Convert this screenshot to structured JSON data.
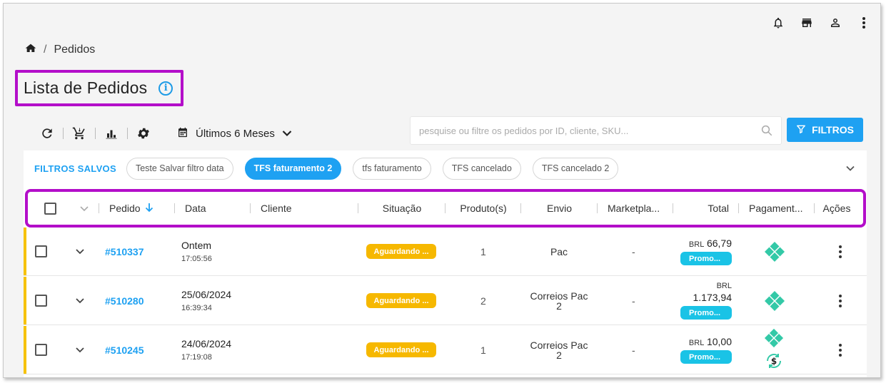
{
  "breadcrumb": {
    "current": "Pedidos",
    "separator": "/"
  },
  "page": {
    "title": "Lista de Pedidos"
  },
  "toolbar": {
    "period_label": "Últimos 6 Meses"
  },
  "search": {
    "placeholder": "pesquise ou filtre os pedidos por ID, cliente, SKU..."
  },
  "filters_button": {
    "label": "FILTROS"
  },
  "saved_filters": {
    "label": "FILTROS SALVOS",
    "chips": [
      {
        "label": "Teste Salvar filtro data",
        "active": false
      },
      {
        "label": "TFS faturamento 2",
        "active": true
      },
      {
        "label": "tfs faturamento",
        "active": false
      },
      {
        "label": "TFS cancelado",
        "active": false
      },
      {
        "label": "TFS cancelado 2",
        "active": false
      }
    ]
  },
  "table": {
    "headers": {
      "pedido": "Pedido",
      "data": "Data",
      "cliente": "Cliente",
      "situacao": "Situação",
      "produtos": "Produto(s)",
      "envio": "Envio",
      "marketplace": "Marketpla...",
      "total": "Total",
      "pagamento": "Pagament...",
      "acoes": "Ações"
    },
    "rows": [
      {
        "id": "#510337",
        "date": "Ontem",
        "time": "17:05:56",
        "status": "Aguardando ...",
        "qty": "1",
        "shipping_l1": "Pac",
        "shipping_l2": "",
        "marketplace": "-",
        "currency": "BRL",
        "amount": "66,79",
        "promo": "Promo..."
      },
      {
        "id": "#510280",
        "date": "25/06/2024",
        "time": "16:39:34",
        "status": "Aguardando ...",
        "qty": "2",
        "shipping_l1": "Correios Pac",
        "shipping_l2": "2",
        "marketplace": "-",
        "currency": "BRL",
        "amount": "1.173,94",
        "promo": "Promo..."
      },
      {
        "id": "#510245",
        "date": "24/06/2024",
        "time": "17:19:08",
        "status": "Aguardando ...",
        "qty": "1",
        "shipping_l1": "Correios Pac",
        "shipping_l2": "2",
        "marketplace": "-",
        "currency": "BRL",
        "amount": "10,00",
        "promo": "Promo..."
      }
    ]
  },
  "colors": {
    "accent": "#1ea1f2",
    "highlight": "#b30ec9",
    "status": "#f6b800",
    "promo": "#1ac3e6",
    "pix": "#33c9a7"
  },
  "icons": [
    "bell-icon",
    "store-icon",
    "user-icon",
    "more-vert-icon",
    "home-icon",
    "info-icon",
    "refresh-icon",
    "cart-icon",
    "bar-chart-icon",
    "gear-icon",
    "calendar-icon",
    "chevron-down-icon",
    "search-icon",
    "filter-icon",
    "arrow-down-icon",
    "pix-icon",
    "refund-icon"
  ]
}
